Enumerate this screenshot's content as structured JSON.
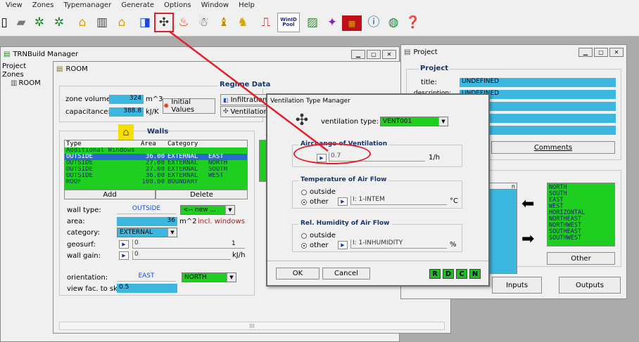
{
  "menu": [
    "View",
    "Zones",
    "Typemanager",
    "Generate",
    "Options",
    "Window",
    "Help"
  ],
  "toolbar": {
    "icons": [
      "open-icon",
      "folder-icon",
      "tree-icon",
      "tree-icon",
      "house-icon",
      "layers-icon",
      "window-house-icon",
      "window-icon",
      "fan-icon",
      "fire-icon",
      "snowman-icon",
      "candle-icon",
      "person-icon",
      "pulse-icon",
      "wind-pool-icon",
      "paint-icon",
      "wand-icon",
      "calendar-icon",
      "info-icon",
      "globe-icon",
      "help-book-icon"
    ],
    "wind_pool_label": "WinID\nPool"
  },
  "trnbuild": {
    "title": "TRNBuild Manager",
    "tree": {
      "project": "Project",
      "zones": "Zones",
      "room": "ROOM"
    },
    "room_title": "ROOM",
    "regime_data": "Regime Data",
    "zone_volume_label": "zone volume:",
    "zone_volume_value": "324",
    "zone_volume_unit": "m^3",
    "capacitance_label": "capacitance:",
    "capacitance_value": "388.8",
    "capacitance_unit": "kJ/K",
    "initial_values": "Initial Values",
    "infiltration": "Infiltration",
    "ventilation": "Ventilation",
    "walls_title": "Walls",
    "walls_headers": {
      "type": "Type",
      "area": "Area",
      "category": "Category"
    },
    "walls_rows": [
      {
        "type": "Additional Windows",
        "area": "",
        "category": "",
        "orient": "",
        "style": "green"
      },
      {
        "type": "OUTSIDE",
        "area": "36.00",
        "category": "EXTERNAL",
        "orient": "EAST",
        "style": "selected"
      },
      {
        "type": "OUTSIDE",
        "area": "27.00",
        "category": "EXTERNAL",
        "orient": "NORTH",
        "style": "green"
      },
      {
        "type": "OUTSIDE",
        "area": "27.00",
        "category": "EXTERNAL",
        "orient": "SOUTH",
        "style": "green"
      },
      {
        "type": "OUTSIDE",
        "area": "36.00",
        "category": "EXTERNAL",
        "orient": "WEST",
        "style": "green"
      },
      {
        "type": "ROOF",
        "area": "108.00",
        "category": "BOUNDARY",
        "orient": "",
        "style": "green"
      }
    ],
    "add": "Add",
    "delete": "Delete",
    "wall_type_label": "wall type:",
    "wall_type_value": "OUTSIDE",
    "wall_new_combo": "<-- new ...",
    "area_label": "area:",
    "area_value": "36",
    "area_unit": "m^2",
    "incl_windows": "incl. windows",
    "category_label": "category:",
    "category_value": "EXTERNAL",
    "geosurf_label": "geosurf:",
    "geosurf_value": "0",
    "geosurf_max": "1",
    "wall_gain_label": "wall gain:",
    "wall_gain_value": "0",
    "wall_gain_unit": "kJ/h",
    "orientation_label": "orientation:",
    "orientation_value": "EAST",
    "orientation_combo": "NORTH",
    "view_fac_label": "view fac. to sky:",
    "view_fac_value": "0.5",
    "hscroll_center": "III"
  },
  "project": {
    "title": "Project",
    "section": "Project",
    "title_label": "title:",
    "title_value": "UNDEFINED",
    "description_label": "description:",
    "description_value": "UNDEFINED",
    "comments": "Comments",
    "orientations": [
      "NORTH",
      "SOUTH",
      "EAST",
      "WEST",
      "HORIZONTAL",
      "NORTHEAST",
      "NORTHWEST",
      "SOUTHEAST",
      "SOUTHWEST"
    ],
    "other": "Other",
    "inputs": "Inputs",
    "outputs": "Outputs"
  },
  "ventilation_dialog": {
    "title": "Ventilation Type Manager",
    "type_label": "ventilation type:",
    "type_value": "VENT001",
    "airchange_title": "Airchange of Ventilation",
    "airchange_value": "0.7",
    "airchange_unit": "1/h",
    "temperature_title": "Temperature of Air Flow",
    "outside": "outside",
    "other": "other",
    "temperature_value": "I: 1-INTEM",
    "temperature_unit": "°C",
    "humidity_title": "Rel. Humidity of Air Flow",
    "humidity_value": "I: 1-INHUMIDITY",
    "humidity_unit": "%",
    "ok": "OK",
    "cancel": "Cancel",
    "r": "R",
    "d": "D",
    "c": "C",
    "n": "N"
  },
  "colors": {
    "accent_field": "#3cb7e0",
    "green": "#1fcf1f",
    "annotation_red": "#e0202a",
    "group_title": "#16346b"
  }
}
